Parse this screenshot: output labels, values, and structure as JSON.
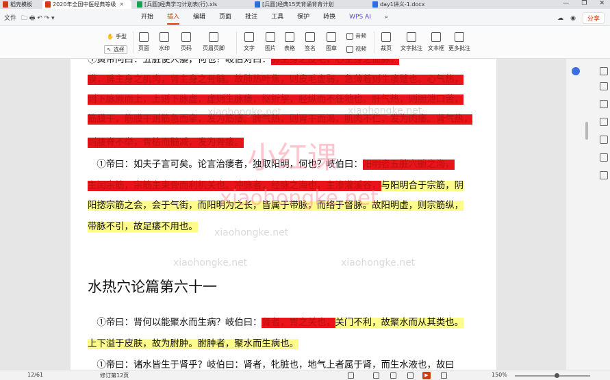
{
  "tabs": [
    {
      "label": "稻壳模板",
      "color": "#d4380d"
    },
    {
      "label": "2020年全国中医经典等级",
      "color": "#d4380d"
    },
    {
      "label": "[兵圆]经典学习计划表(行).xls",
      "color": "#1e9e54"
    },
    {
      "label": "[兵圆]经典15天背诵背背计划",
      "color": "#2b6de3"
    },
    {
      "label": "day1讲义-1.docx",
      "color": "#2b6de3"
    }
  ],
  "window": {
    "minimize": "—",
    "restore": "❐",
    "close": "✕"
  },
  "quick_access": {
    "file": "文件",
    "icons": "🗀 🖶 ↶ ↷ ▾"
  },
  "menu": [
    "开始",
    "插入",
    "编辑",
    "页面",
    "批注",
    "工具",
    "保护",
    "转换",
    "WPS AI"
  ],
  "menu_active": "插入",
  "menu_right": {
    "share": "分享",
    "search_icon": "search-icon"
  },
  "ribbon": {
    "hand": "手型",
    "select": "选择",
    "items": [
      "页面",
      "水印",
      "页码",
      "页眉页脚",
      "文字",
      "图片",
      "表格",
      "签名",
      "图章",
      "音频",
      "视频",
      "裁页",
      "文字批注",
      "文本框",
      "更多批注"
    ]
  },
  "doc": {
    "lines": [
      {
        "segments": [
          {
            "t": "①黄帝问曰：五脏使人痿，何也？岐伯对曰：",
            "h": "none"
          },
          {
            "t": "肺主身之皮毛，心主身之血脉，",
            "h": "red"
          }
        ]
      },
      {
        "segments": [
          {
            "t": "膜，脾主身之肌肉，肾主身之骨髓。故肺热叶焦，则皮毛虚弱，急薄着则生痿躄也。心气热，",
            "h": "red"
          }
        ]
      },
      {
        "segments": [
          {
            "t": "则下脉厥而上，上则下脉虚，虚则生脉痿，枢折挈，胫纵而不任地也。肝气热，则胆泄口苦，",
            "h": "red"
          }
        ]
      },
      {
        "segments": [
          {
            "t": "筋膜干，筋膜干则筋急而挛，发为筋痿。脾气热，则胃干而渴，肌肉不仁，发为肉痿。肾气热，",
            "h": "red"
          }
        ]
      },
      {
        "segments": [
          {
            "t": "则腰脊不举，骨枯而髓减，发为骨痿。",
            "h": "red"
          }
        ]
      },
      {
        "segments": [
          {
            "t": "　①帝曰：如夫子言可矣。论言治痿者，独取阳明，何也？岐伯曰：",
            "h": "none"
          },
          {
            "t": "阳明者五脏六腑之海，",
            "h": "red"
          }
        ]
      },
      {
        "segments": [
          {
            "t": "主闰宗筋，宗筋主束骨而利机关也。冲脉者，经脉之海也，主渗灌溪谷，",
            "h": "red"
          },
          {
            "t": "与阳明合于宗筋，阴",
            "h": "yellow"
          }
        ]
      },
      {
        "segments": [
          {
            "t": "阳揔宗筋之会，会于气街，而阳明为之长，皆属于带脉，而络于督脉。故阳明虚，则宗筋纵，",
            "h": "yellow"
          }
        ]
      },
      {
        "segments": [
          {
            "t": "带脉不引，故足痿不用也。",
            "h": "yellow"
          }
        ]
      },
      {
        "segments": [
          {
            "t": "　①帝曰：肾何以能聚水而生病？岐伯曰：",
            "h": "none"
          },
          {
            "t": "肾者，胃之关也，",
            "h": "red"
          },
          {
            "t": "关门不利，故聚水而从其类也。",
            "h": "yellow"
          }
        ]
      },
      {
        "segments": [
          {
            "t": "上下溢于皮肤，故为胕肿。胕肿者，聚水而生病也。",
            "h": "yellow"
          }
        ]
      },
      {
        "segments": [
          {
            "t": "　①帝曰：诸水皆生于肾乎？岐伯曰：肾者，牝脏也，地气上者属于肾，而生水液也，故曰",
            "h": "none"
          }
        ]
      }
    ],
    "heading": "水热穴论篇第六十一",
    "watermark_small": "xiaohongke.net",
    "watermark_big_cn": "小红课",
    "watermark_big_en": "xiaohongke.net"
  },
  "status": {
    "page": "12/61",
    "revision": "修订第12页",
    "zoom": "150%",
    "zoom_level": 0.55
  }
}
